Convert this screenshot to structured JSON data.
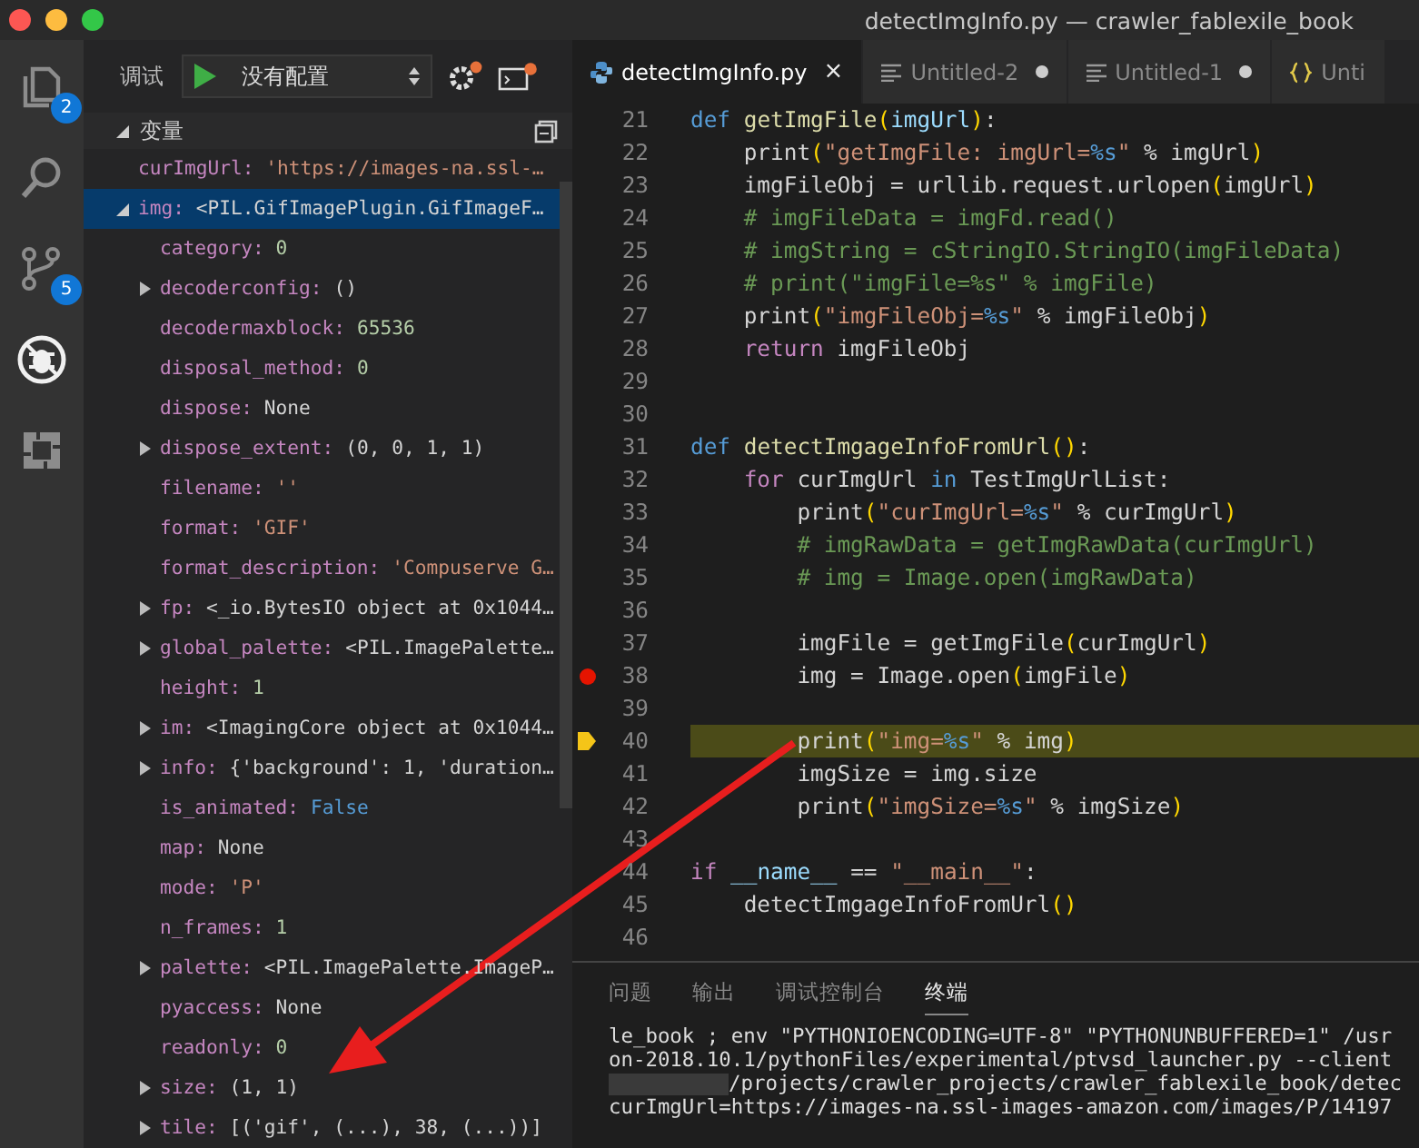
{
  "window": {
    "title": "detectImgInfo.py — crawler_fablexile_book"
  },
  "activity_bar": [
    {
      "kind": "files",
      "badge": "2",
      "selected": false
    },
    {
      "kind": "search",
      "selected": false
    },
    {
      "kind": "source-control",
      "badge": "5",
      "selected": false
    },
    {
      "kind": "debug",
      "selected": true
    },
    {
      "kind": "extensions",
      "selected": false
    }
  ],
  "debug_toolbar": {
    "label": "调试",
    "configuration": "没有配置",
    "settings_alert": true,
    "console_alert": true
  },
  "variables": {
    "title": "变量",
    "expanded": true,
    "items": [
      {
        "name": "curImgUrl:",
        "value": "'https://images-na.ssl-…",
        "kind": "string",
        "expandable": false,
        "selected": false
      },
      {
        "name": "img:",
        "value": "<PIL.GifImagePlugin.GifImageF…",
        "kind": "object",
        "expandable": true,
        "expanded": true,
        "selected": true,
        "children": [
          {
            "name": "category:",
            "value": "0",
            "kind": "number",
            "expandable": false,
            "selected": false
          },
          {
            "name": "decoderconfig:",
            "value": "()",
            "kind": "object",
            "expandable": true,
            "expanded": false,
            "selected": false
          },
          {
            "name": "decodermaxblock:",
            "value": "65536",
            "kind": "number",
            "expandable": false,
            "selected": false
          },
          {
            "name": "disposal_method:",
            "value": "0",
            "kind": "number",
            "expandable": false,
            "selected": false
          },
          {
            "name": "dispose:",
            "value": "None",
            "kind": "object",
            "expandable": false,
            "selected": false
          },
          {
            "name": "dispose_extent:",
            "value": "(0, 0, 1, 1)",
            "kind": "object",
            "expandable": true,
            "expanded": false,
            "selected": false
          },
          {
            "name": "filename:",
            "value": "''",
            "kind": "string",
            "expandable": false,
            "selected": false
          },
          {
            "name": "format:",
            "value": "'GIF'",
            "kind": "string",
            "expandable": false,
            "selected": false
          },
          {
            "name": "format_description:",
            "value": "'Compuserve G…",
            "kind": "string",
            "expandable": false,
            "selected": false
          },
          {
            "name": "fp:",
            "value": "<_io.BytesIO object at 0x1044…",
            "kind": "object",
            "expandable": true,
            "expanded": false,
            "selected": false
          },
          {
            "name": "global_palette:",
            "value": "<PIL.ImagePalette…",
            "kind": "object",
            "expandable": true,
            "expanded": false,
            "selected": false
          },
          {
            "name": "height:",
            "value": "1",
            "kind": "number",
            "expandable": false,
            "selected": false
          },
          {
            "name": "im:",
            "value": "<ImagingCore object at 0x1044…",
            "kind": "object",
            "expandable": true,
            "expanded": false,
            "selected": false
          },
          {
            "name": "info:",
            "value": "{'background': 1, 'duration…",
            "kind": "object",
            "expandable": true,
            "expanded": false,
            "selected": false
          },
          {
            "name": "is_animated:",
            "value": "False",
            "kind": "boolean",
            "expandable": false,
            "selected": false
          },
          {
            "name": "map:",
            "value": "None",
            "kind": "object",
            "expandable": false,
            "selected": false
          },
          {
            "name": "mode:",
            "value": "'P'",
            "kind": "string",
            "expandable": false,
            "selected": false
          },
          {
            "name": "n_frames:",
            "value": "1",
            "kind": "number",
            "expandable": false,
            "selected": false
          },
          {
            "name": "palette:",
            "value": "<PIL.ImagePalette.ImageP…",
            "kind": "object",
            "expandable": true,
            "expanded": false,
            "selected": false
          },
          {
            "name": "pyaccess:",
            "value": "None",
            "kind": "object",
            "expandable": false,
            "selected": false
          },
          {
            "name": "readonly:",
            "value": "0",
            "kind": "number",
            "expandable": false,
            "selected": false
          },
          {
            "name": "size:",
            "value": "(1, 1)",
            "kind": "object",
            "expandable": true,
            "expanded": false,
            "selected": false
          },
          {
            "name": "tile:",
            "value": "[('gif', (...), 38, (...))]",
            "kind": "object",
            "expandable": true,
            "expanded": false,
            "selected": false
          }
        ]
      }
    ]
  },
  "tabs": [
    {
      "label": "detectImgInfo.py",
      "kind": "python",
      "selected": true,
      "dirty": false,
      "close": "×"
    },
    {
      "label": "Untitled-2",
      "kind": "text",
      "selected": false,
      "dirty": true
    },
    {
      "label": "Untitled-1",
      "kind": "text",
      "selected": false,
      "dirty": true
    },
    {
      "label": "Unti",
      "kind": "json",
      "selected": false,
      "dirty": false
    }
  ],
  "code_lines": [
    {
      "number": "21",
      "breakpoint": false,
      "current": false,
      "tokens": [
        {
          "t": "def",
          "kind": "kw"
        },
        {
          "t": " getImgFile",
          "kind": "fn"
        },
        {
          "t": "(",
          "kind": "br"
        },
        {
          "t": "imgUrl",
          "kind": "var"
        },
        {
          "t": ")",
          "kind": "br"
        },
        {
          "t": ":",
          "kind": "p"
        }
      ]
    },
    {
      "number": "22",
      "breakpoint": false,
      "current": false,
      "tokens": [
        {
          "t": "    print",
          "kind": "p"
        },
        {
          "t": "(",
          "kind": "br"
        },
        {
          "t": "\"getImgFile: imgUrl=",
          "kind": "str"
        },
        {
          "t": "%s",
          "kind": "fmt"
        },
        {
          "t": "\"",
          "kind": "str"
        },
        {
          "t": " % imgUrl",
          "kind": "p"
        },
        {
          "t": ")",
          "kind": "br"
        }
      ]
    },
    {
      "number": "23",
      "breakpoint": false,
      "current": false,
      "tokens": [
        {
          "t": "    imgFileObj = urllib.request.urlopen",
          "kind": "p"
        },
        {
          "t": "(",
          "kind": "br"
        },
        {
          "t": "imgUrl",
          "kind": "p"
        },
        {
          "t": ")",
          "kind": "br"
        }
      ]
    },
    {
      "number": "24",
      "breakpoint": false,
      "current": false,
      "tokens": [
        {
          "t": "    # imgFileData = imgFd.read()",
          "kind": "cm"
        }
      ]
    },
    {
      "number": "25",
      "breakpoint": false,
      "current": false,
      "tokens": [
        {
          "t": "    # imgString = cStringIO.StringIO(imgFileData)",
          "kind": "cm"
        }
      ]
    },
    {
      "number": "26",
      "breakpoint": false,
      "current": false,
      "tokens": [
        {
          "t": "    # print(\"imgFile=%s\" % imgFile)",
          "kind": "cm"
        }
      ]
    },
    {
      "number": "27",
      "breakpoint": false,
      "current": false,
      "tokens": [
        {
          "t": "    print",
          "kind": "p"
        },
        {
          "t": "(",
          "kind": "br"
        },
        {
          "t": "\"imgFileObj=",
          "kind": "str"
        },
        {
          "t": "%s",
          "kind": "fmt"
        },
        {
          "t": "\"",
          "kind": "str"
        },
        {
          "t": " % imgFileObj",
          "kind": "p"
        },
        {
          "t": ")",
          "kind": "br"
        }
      ]
    },
    {
      "number": "28",
      "breakpoint": false,
      "current": false,
      "tokens": [
        {
          "t": "    return",
          "kind": "ctl"
        },
        {
          "t": " imgFileObj",
          "kind": "p"
        }
      ]
    },
    {
      "number": "29",
      "breakpoint": false,
      "current": false
    },
    {
      "number": "30",
      "breakpoint": false,
      "current": false
    },
    {
      "number": "31",
      "breakpoint": false,
      "current": false,
      "tokens": [
        {
          "t": "def",
          "kind": "kw"
        },
        {
          "t": " detectImgageInfoFromUrl",
          "kind": "fn"
        },
        {
          "t": "()",
          "kind": "br"
        },
        {
          "t": ":",
          "kind": "p"
        }
      ]
    },
    {
      "number": "32",
      "breakpoint": false,
      "current": false,
      "tokens": [
        {
          "t": "    for",
          "kind": "ctl"
        },
        {
          "t": " curImgUrl ",
          "kind": "p"
        },
        {
          "t": "in",
          "kind": "kw"
        },
        {
          "t": " TestImgUrlList:",
          "kind": "p"
        }
      ]
    },
    {
      "number": "33",
      "breakpoint": false,
      "current": false,
      "tokens": [
        {
          "t": "        print",
          "kind": "p"
        },
        {
          "t": "(",
          "kind": "br"
        },
        {
          "t": "\"curImgUrl=",
          "kind": "str"
        },
        {
          "t": "%s",
          "kind": "fmt"
        },
        {
          "t": "\"",
          "kind": "str"
        },
        {
          "t": " % curImgUrl",
          "kind": "p"
        },
        {
          "t": ")",
          "kind": "br"
        }
      ]
    },
    {
      "number": "34",
      "breakpoint": false,
      "current": false,
      "tokens": [
        {
          "t": "        # imgRawData = getImgRawData(curImgUrl)",
          "kind": "cm"
        }
      ]
    },
    {
      "number": "35",
      "breakpoint": false,
      "current": false,
      "tokens": [
        {
          "t": "        # img = Image.open(imgRawData)",
          "kind": "cm"
        }
      ]
    },
    {
      "number": "36",
      "breakpoint": false,
      "current": false
    },
    {
      "number": "37",
      "breakpoint": false,
      "current": false,
      "tokens": [
        {
          "t": "        imgFile = getImgFile",
          "kind": "p"
        },
        {
          "t": "(",
          "kind": "br"
        },
        {
          "t": "curImgUrl",
          "kind": "p"
        },
        {
          "t": ")",
          "kind": "br"
        }
      ]
    },
    {
      "number": "38",
      "breakpoint": true,
      "current": false,
      "tokens": [
        {
          "t": "        img = Image.open",
          "kind": "p"
        },
        {
          "t": "(",
          "kind": "br"
        },
        {
          "t": "imgFile",
          "kind": "p"
        },
        {
          "t": ")",
          "kind": "br"
        }
      ]
    },
    {
      "number": "39",
      "breakpoint": false,
      "current": false
    },
    {
      "number": "40",
      "breakpoint": false,
      "current": true,
      "tokens": [
        {
          "t": "        print",
          "kind": "p"
        },
        {
          "t": "(",
          "kind": "br"
        },
        {
          "t": "\"img=",
          "kind": "str"
        },
        {
          "t": "%s",
          "kind": "fmt"
        },
        {
          "t": "\"",
          "kind": "str"
        },
        {
          "t": " % img",
          "kind": "p"
        },
        {
          "t": ")",
          "kind": "br"
        }
      ]
    },
    {
      "number": "41",
      "breakpoint": false,
      "current": false,
      "tokens": [
        {
          "t": "        imgSize = img.size",
          "kind": "p"
        }
      ]
    },
    {
      "number": "42",
      "breakpoint": false,
      "current": false,
      "tokens": [
        {
          "t": "        print",
          "kind": "p"
        },
        {
          "t": "(",
          "kind": "br"
        },
        {
          "t": "\"imgSize=",
          "kind": "str"
        },
        {
          "t": "%s",
          "kind": "fmt"
        },
        {
          "t": "\"",
          "kind": "str"
        },
        {
          "t": " % imgSize",
          "kind": "p"
        },
        {
          "t": ")",
          "kind": "br"
        }
      ]
    },
    {
      "number": "43",
      "breakpoint": false,
      "current": false
    },
    {
      "number": "44",
      "breakpoint": false,
      "current": false,
      "tokens": [
        {
          "t": "if",
          "kind": "ctl"
        },
        {
          "t": " __name__",
          "kind": "var"
        },
        {
          "t": " == ",
          "kind": "p"
        },
        {
          "t": "\"__main__\"",
          "kind": "str"
        },
        {
          "t": ":",
          "kind": "p"
        }
      ]
    },
    {
      "number": "45",
      "breakpoint": false,
      "current": false,
      "tokens": [
        {
          "t": "    detectImgageInfoFromUrl",
          "kind": "p"
        },
        {
          "t": "()",
          "kind": "br"
        }
      ]
    },
    {
      "number": "46",
      "breakpoint": false,
      "current": false
    }
  ],
  "panel": {
    "tabs": [
      {
        "label": "问题",
        "selected": false
      },
      {
        "label": "输出",
        "selected": false
      },
      {
        "label": "调试控制台",
        "selected": false
      },
      {
        "label": "终端",
        "selected": true
      }
    ],
    "terminal_lines": [
      {
        "text": "le_book ; env \"PYTHONIOENCODING=UTF-8\" \"PYTHONUNBUFFERED=1\" /usr",
        "redacted": false
      },
      {
        "text": "on-2018.10.1/pythonFiles/experimental/ptvsd_launcher.py --client",
        "redacted": false
      },
      {
        "text": "/projects/crawler_projects/crawler_fablexile_book/detec",
        "redacted": true
      },
      {
        "text": "curImgUrl=https://images-na.ssl-images-amazon.com/images/P/14197",
        "redacted": false
      }
    ]
  },
  "annotation": {
    "kind": "arrow"
  }
}
